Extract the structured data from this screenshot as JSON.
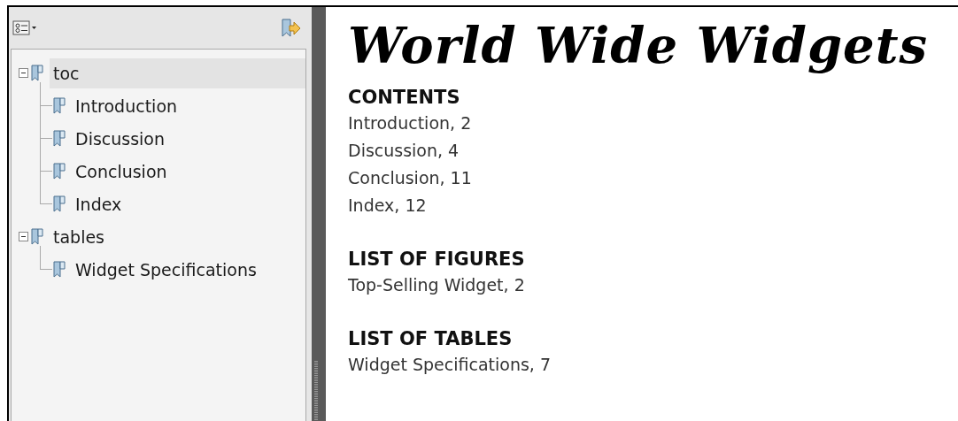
{
  "sidebar": {
    "tree": [
      {
        "label": "toc",
        "selected": true,
        "expanded": true,
        "children": [
          {
            "label": "Introduction",
            "selected": false
          },
          {
            "label": "Discussion",
            "selected": false
          },
          {
            "label": "Conclusion",
            "selected": false
          },
          {
            "label": "Index",
            "selected": false
          }
        ]
      },
      {
        "label": "tables",
        "selected": false,
        "expanded": true,
        "children": [
          {
            "label": "Widget Specifications",
            "selected": false
          }
        ]
      }
    ]
  },
  "document": {
    "title": "World Wide Widgets",
    "sections": [
      {
        "heading": "CONTENTS",
        "entries": [
          "Introduction, 2",
          "Discussion, 4",
          "Conclusion, 11",
          "Index, 12"
        ]
      },
      {
        "heading": "LIST OF FIGURES",
        "entries": [
          "Top-Selling Widget, 2"
        ]
      },
      {
        "heading": "LIST OF TABLES",
        "entries": [
          "Widget Specifications, 7"
        ]
      }
    ]
  }
}
